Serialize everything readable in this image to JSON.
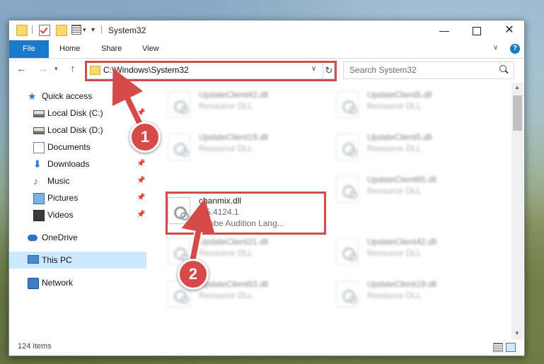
{
  "window": {
    "title": "System32"
  },
  "ribbon": {
    "tabs": [
      "File",
      "Home",
      "Share",
      "View"
    ],
    "help": "?"
  },
  "nav": {
    "address": "C:\\Windows\\System32",
    "search_placeholder": "Search System32"
  },
  "sidebar": {
    "items": [
      {
        "label": "Quick access",
        "icon": "star-icon"
      },
      {
        "label": "Local Disk (C:)",
        "icon": "disk-icon",
        "pinned": true
      },
      {
        "label": "Local Disk (D:)",
        "icon": "disk-icon"
      },
      {
        "label": "Documents",
        "icon": "documents-icon",
        "pinned": true
      },
      {
        "label": "Downloads",
        "icon": "download-icon",
        "pinned": true
      },
      {
        "label": "Music",
        "icon": "music-icon",
        "pinned": true
      },
      {
        "label": "Pictures",
        "icon": "pictures-icon",
        "pinned": true
      },
      {
        "label": "Videos",
        "icon": "videos-icon",
        "pinned": true
      },
      {
        "label": "OneDrive",
        "icon": "onedrive-icon"
      },
      {
        "label": "This PC",
        "icon": "pc-icon",
        "selected": true
      },
      {
        "label": "Network",
        "icon": "network-icon"
      }
    ]
  },
  "files": [
    {
      "name": "UpdateClient42.dll",
      "type": "Resource DLL"
    },
    {
      "name": "UpdateClient5.dll",
      "type": "Resource DLL"
    },
    {
      "name": "UpdateClient19.dll",
      "type": "Resource DLL"
    },
    {
      "name": "UpdateClient5.dll",
      "type": "Resource DLL"
    },
    {
      "name": "chanmix.dll",
      "type": "1.5.4124.1",
      "desc": "Adobe Audition Lang..."
    },
    {
      "name": "UpdateClient65.dll",
      "type": "Resource DLL"
    },
    {
      "name": "UpdateClient21.dll",
      "type": "Resource DLL"
    },
    {
      "name": "UpdateClient42.dll",
      "type": "Resource DLL"
    },
    {
      "name": "UpdateClient63.dll",
      "type": "Resource DLL"
    },
    {
      "name": "UpdateClient19.dll",
      "type": "Resource DLL"
    }
  ],
  "status": {
    "items": "124 items"
  },
  "annotations": {
    "badge1": "1",
    "badge2": "2",
    "color": "#d64a4a"
  }
}
